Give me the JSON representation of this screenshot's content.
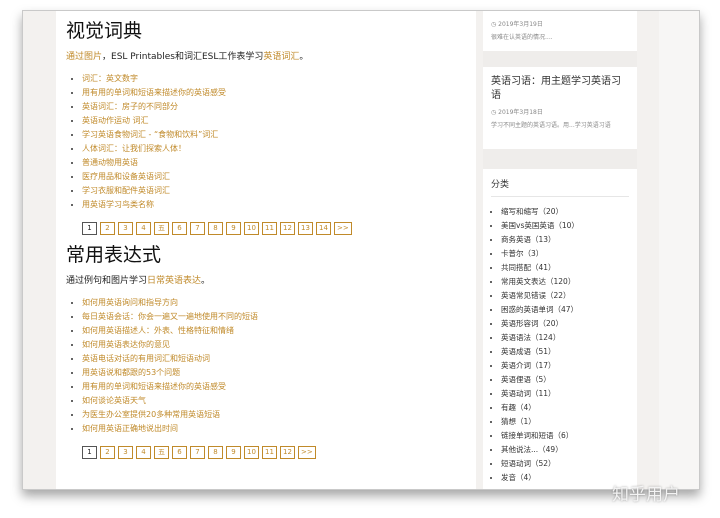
{
  "section1": {
    "title": "视觉词典",
    "intro_link1": "通过图片",
    "intro_middle": "，ESL Printables和词汇ESL工作表学习",
    "intro_link2": "英语词汇",
    "intro_end": "。",
    "links": [
      "词汇：英文数字",
      "用有用的单词和短语来描述你的英语感受",
      "英语词汇：房子的不同部分",
      "英语动作运动 词汇",
      "学习英语食物词汇 - “食物和饮料”词汇",
      "人体词汇：让我们探索人体！",
      "普通动物用英语",
      "医疗用品和设备英语词汇",
      "学习衣服和配件英语词汇",
      "用英语学习鸟类名称"
    ],
    "pages": [
      "1",
      "2",
      "3",
      "4",
      "五",
      "6",
      "7",
      "8",
      "9",
      "10",
      "11",
      "12",
      "13",
      "14",
      ">>"
    ]
  },
  "section2": {
    "title": "常用表达式",
    "intro_start": "通过例句和图片学习",
    "intro_link": "日常英语表达",
    "intro_end": "。",
    "links": [
      "如何用英语询问和指导方向",
      "每日英语会话：你会一遍又一遍地使用不同的短语",
      "如何用英语描述人：外表、性格特征和情绪",
      "如何用英语表达你的意见",
      "英语电话对话的有用词汇和短语动词",
      "用英语说和都跟的53个问题",
      "用有用的单词和短语来描述你的英语感受",
      "如何谈论英语天气",
      "为医生办公室提供20多种常用英语短语",
      "如何用英语正确地说出时间"
    ],
    "pages": [
      "1",
      "2",
      "3",
      "4",
      "五",
      "6",
      "7",
      "8",
      "9",
      "10",
      "11",
      "12",
      ">>"
    ]
  },
  "sidebar": {
    "post1": {
      "date": "2019年3月19日",
      "excerpt": "很难在认英语的情况...."
    },
    "post2": {
      "title": "英语习语：用主题学习英语习语",
      "date": "2019年3月18日",
      "excerpt": "学习不同主题的英语习语。用...学习英语习语"
    },
    "categories_title": "分类",
    "categories": [
      "缩写和缩写（20）",
      "美国vs英国英语（10）",
      "商务英语（13）",
      "卡普尔（3）",
      "共同搭配（41）",
      "常用英文表达（120）",
      "英语常见错误（22）",
      "困惑的英语单词（47）",
      "英语形容词（20）",
      "英语语法（124）",
      "英语成语（51）",
      "英语介词（17）",
      "英语俚语（5）",
      "英语动词（11）",
      "有趣（4）",
      "猜想（1）",
      "链接单词和短语（6）",
      "其他说法...（49）",
      "短语动词（52）",
      "发音（4）"
    ]
  },
  "watermark": "知乎用户",
  "colors": {
    "link": "#c08a2a",
    "sidebar_bg": "#efedeb"
  }
}
